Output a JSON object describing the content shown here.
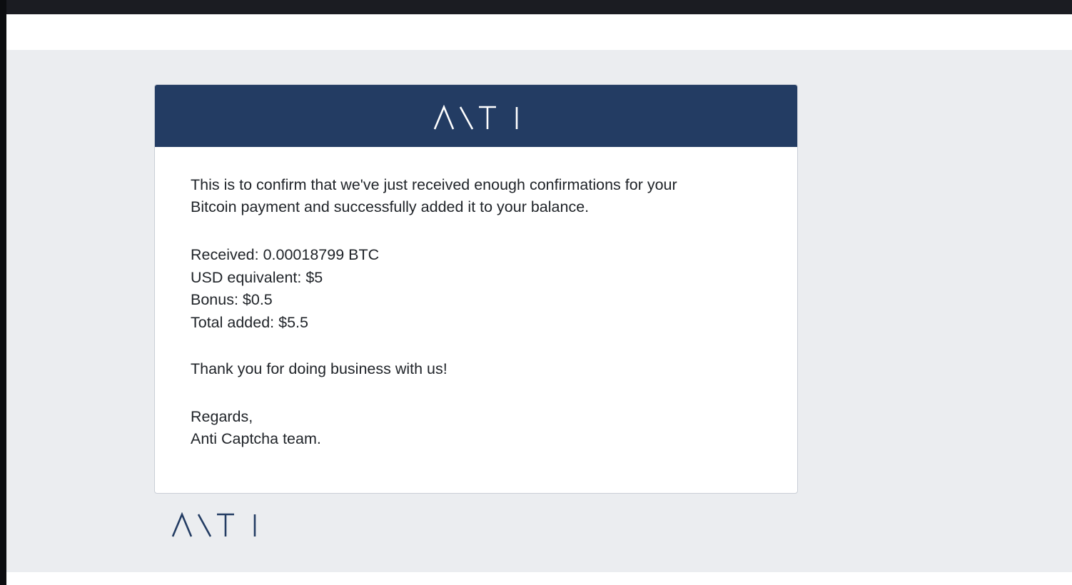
{
  "colors": {
    "header_bg": "#233c63",
    "page_bg": "#ebedf0",
    "card_bg": "#ffffff",
    "text": "#1f2328",
    "logo_header": "#ffffff",
    "logo_footer": "#233c63"
  },
  "icons": {
    "header_logo": "anti-captcha-logo-icon",
    "footer_logo": "anti-captcha-logo-icon"
  },
  "email": {
    "intro_line1": "This is to confirm that we've just received enough confirmations for your",
    "intro_line2": "Bitcoin payment and successfully added it to your balance.",
    "received": "Received: 0.00018799 BTC",
    "usd_equivalent": "USD equivalent: $5",
    "bonus": "Bonus: $0.5",
    "total_added": "Total added: $5.5",
    "thanks": "Thank you for doing business with us!",
    "regards": "Regards,",
    "signature": "Anti Captcha team."
  }
}
